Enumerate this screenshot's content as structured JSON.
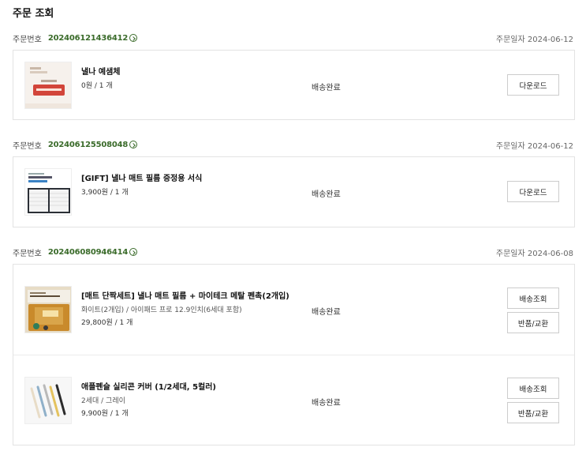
{
  "page": {
    "title": "주문 조회"
  },
  "labels": {
    "order_no": "주문번호",
    "order_date": "주문일자"
  },
  "colors": {
    "accent": "#3a6b2a",
    "border": "#e3e3e3"
  },
  "orders": [
    {
      "order_no": "2024061214364​12",
      "date": "2024-06-12",
      "items": [
        {
          "thumb": "ebook-cover-icon",
          "name": "낼나 예샘체",
          "option": "",
          "price": "0원 / 1 개",
          "status": "배송완료",
          "buttons": [
            "다운로드"
          ]
        }
      ]
    },
    {
      "order_no": "202406125508048",
      "date": "2024-06-12",
      "items": [
        {
          "thumb": "planner-form-icon",
          "name": "[GIFT] 낼나 매트 필름 증정용 서식",
          "option": "",
          "price": "3,900원 / 1 개",
          "status": "배송완료",
          "buttons": [
            "다운로드"
          ]
        }
      ]
    },
    {
      "order_no": "202406080946414",
      "date": "2024-06-08",
      "items": [
        {
          "thumb": "film-package-icon",
          "name": "[매트 단짝세트] 낼나 매트 필름 + 마이테크 메탈 펜촉(2개입)",
          "option": "화이트(2개입) / 아이패드 프로 12.9인치(6세대 포함)",
          "price": "29,800원 / 1 개",
          "status": "배송완료",
          "buttons": [
            "배송조회",
            "반품/교환"
          ]
        },
        {
          "thumb": "pencil-covers-icon",
          "name": "애플펜슬 실리콘 커버 (1/2세대, 5컬러)",
          "option": "2세대 / 그레이",
          "price": "9,900원 / 1 개",
          "status": "배송완료",
          "buttons": [
            "배송조회",
            "반품/교환"
          ]
        }
      ]
    }
  ]
}
